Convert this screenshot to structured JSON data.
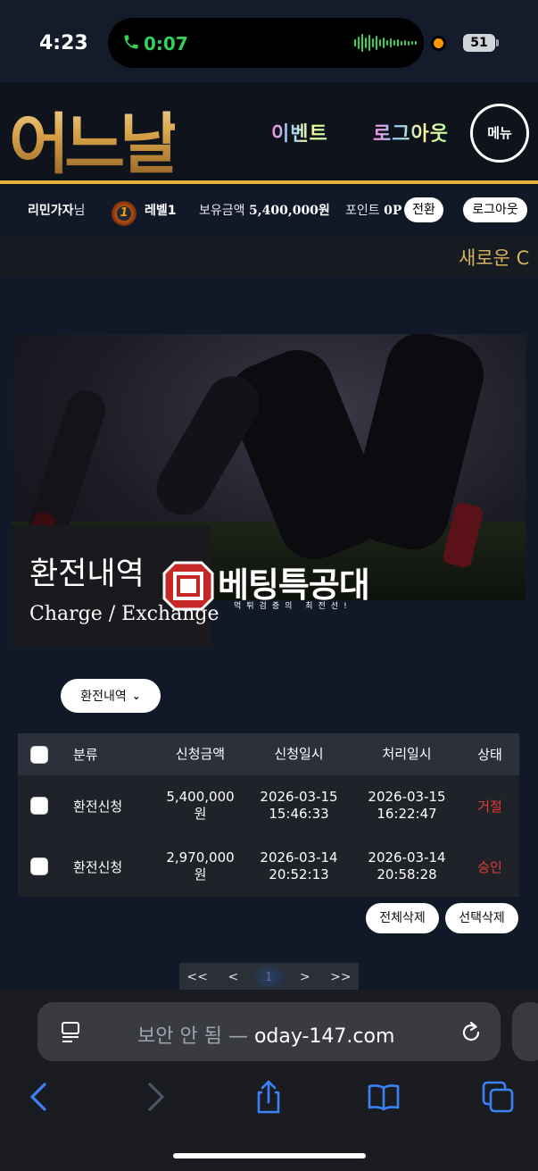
{
  "status_bar": {
    "time": "4:23",
    "call_time": "0:07",
    "battery": "51"
  },
  "header": {
    "logo": "어느날",
    "nav_event": "이벤트",
    "nav_logout": "로그아웃",
    "menu": "메뉴"
  },
  "user": {
    "name": "리민가자",
    "suffix": "님",
    "level_badge": "1",
    "level": "레벨1",
    "balance_label": "보유금액",
    "balance": "5,400,000원",
    "point_label": "포인트",
    "point": "0P",
    "convert": "전환",
    "logout": "로그아웃"
  },
  "ticker": {
    "text": "새로운 C"
  },
  "hero": {
    "title_ko": "환전내역",
    "title_en": "Charge / Exchange"
  },
  "watermark": {
    "text": "베팅특공대",
    "sub": "먹튀검증의 최전선!"
  },
  "filter": {
    "selected": "환전내역"
  },
  "table": {
    "headers": [
      "분류",
      "신청금액",
      "신청일시",
      "처리일시",
      "상태"
    ],
    "rows": [
      {
        "type": "환전신청",
        "amount_1": "5,400,000",
        "amount_2": "원",
        "req_date": "2026-03-15",
        "req_time": "15:46:33",
        "proc_date": "2026-03-15",
        "proc_time": "16:22:47",
        "status": "거절"
      },
      {
        "type": "환전신청",
        "amount_1": "2,970,000",
        "amount_2": "원",
        "req_date": "2026-03-14",
        "req_time": "20:52:13",
        "proc_date": "2026-03-14",
        "proc_time": "20:58:28",
        "status": "승인"
      }
    ]
  },
  "actions": {
    "delete_all": "전체삭제",
    "delete_selected": "선택삭제"
  },
  "pagination": {
    "first": "<<",
    "prev": "<",
    "current": "1",
    "next": ">",
    "last": ">>"
  },
  "browser": {
    "insecure_label": "보안 안 됨 —",
    "domain": "oday-147.com"
  },
  "colors": {
    "accent_gold": "#e4b53b",
    "status_red": "#e53935",
    "call_green": "#34d058"
  }
}
